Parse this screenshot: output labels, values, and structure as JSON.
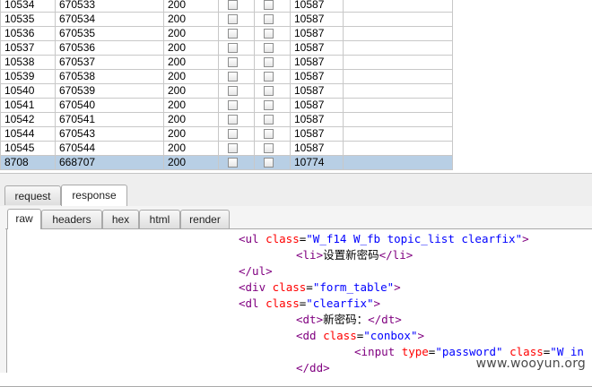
{
  "results": {
    "rows": [
      {
        "request": "10534",
        "payload": "670533",
        "status": "200",
        "length": "10587"
      },
      {
        "request": "10535",
        "payload": "670534",
        "status": "200",
        "length": "10587"
      },
      {
        "request": "10536",
        "payload": "670535",
        "status": "200",
        "length": "10587"
      },
      {
        "request": "10537",
        "payload": "670536",
        "status": "200",
        "length": "10587"
      },
      {
        "request": "10538",
        "payload": "670537",
        "status": "200",
        "length": "10587"
      },
      {
        "request": "10539",
        "payload": "670538",
        "status": "200",
        "length": "10587"
      },
      {
        "request": "10540",
        "payload": "670539",
        "status": "200",
        "length": "10587"
      },
      {
        "request": "10541",
        "payload": "670540",
        "status": "200",
        "length": "10587"
      },
      {
        "request": "10542",
        "payload": "670541",
        "status": "200",
        "length": "10587"
      },
      {
        "request": "10544",
        "payload": "670543",
        "status": "200",
        "length": "10587"
      },
      {
        "request": "10545",
        "payload": "670544",
        "status": "200",
        "length": "10587"
      },
      {
        "request": "8708",
        "payload": "668707",
        "status": "200",
        "length": "10774",
        "selected": true
      }
    ]
  },
  "outer_tabs": [
    {
      "label": "request",
      "active": false
    },
    {
      "label": "response",
      "active": true
    }
  ],
  "inner_tabs": [
    {
      "label": "raw",
      "active": true
    },
    {
      "label": "headers",
      "active": false
    },
    {
      "label": "hex",
      "active": false
    },
    {
      "label": "html",
      "active": false
    },
    {
      "label": "render",
      "active": false
    }
  ],
  "code_lines": [
    {
      "indent": 1,
      "parts": [
        [
          "tag",
          "<ul "
        ],
        [
          "attr",
          "class"
        ],
        [
          "punc",
          "="
        ],
        [
          "val",
          "\"W_f14 W_fb topic_list clearfix\""
        ],
        [
          "tag",
          ">"
        ]
      ]
    },
    {
      "indent": 2,
      "parts": [
        [
          "tag",
          "<li>"
        ],
        [
          "txt",
          "设置新密码"
        ],
        [
          "tag",
          "</li>"
        ]
      ]
    },
    {
      "indent": 1,
      "parts": [
        [
          "tag",
          "</ul>"
        ]
      ]
    },
    {
      "indent": 1,
      "parts": [
        [
          "tag",
          "<div "
        ],
        [
          "attr",
          "class"
        ],
        [
          "punc",
          "="
        ],
        [
          "val",
          "\"form_table\""
        ],
        [
          "tag",
          ">"
        ]
      ]
    },
    {
      "indent": 1,
      "parts": [
        [
          "tag",
          "<dl "
        ],
        [
          "attr",
          "class"
        ],
        [
          "punc",
          "="
        ],
        [
          "val",
          "\"clearfix\""
        ],
        [
          "tag",
          ">"
        ]
      ]
    },
    {
      "indent": 2,
      "parts": [
        [
          "tag",
          "<dt>"
        ],
        [
          "txt",
          "新密码："
        ],
        [
          "tag",
          "</dt>"
        ]
      ]
    },
    {
      "indent": 2,
      "parts": [
        [
          "tag",
          "<dd "
        ],
        [
          "attr",
          "class"
        ],
        [
          "punc",
          "="
        ],
        [
          "val",
          "\"conbox\""
        ],
        [
          "tag",
          ">"
        ]
      ]
    },
    {
      "indent": 3,
      "parts": [
        [
          "tag",
          "<input "
        ],
        [
          "attr",
          "type"
        ],
        [
          "punc",
          "="
        ],
        [
          "val",
          "\"password\""
        ],
        [
          "punc",
          " "
        ],
        [
          "attr",
          "class"
        ],
        [
          "punc",
          "="
        ],
        [
          "val",
          "\"W_in"
        ]
      ]
    },
    {
      "indent": 2,
      "parts": [
        [
          "tag",
          "</dd>"
        ]
      ]
    }
  ],
  "watermark": "www.wooyun.org",
  "colors": {
    "selected_row": "#b8cfe5",
    "tag": "#800080",
    "attr": "#ff0000",
    "value": "#0000ff"
  }
}
